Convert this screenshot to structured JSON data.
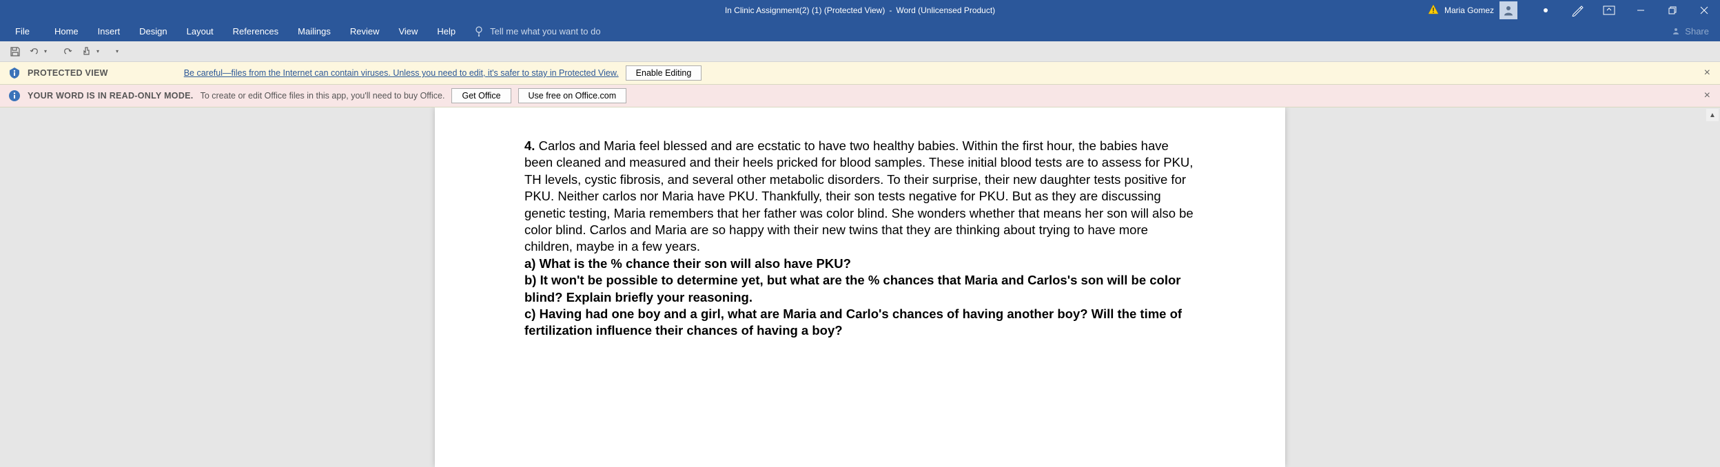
{
  "title": {
    "docname": "In Clinic Assignment(2) (1) (Protected View)",
    "dash": "  -  ",
    "app": "Word (Unlicensed Product)"
  },
  "user": {
    "name": "Maria Gomez"
  },
  "tabs": {
    "file": "File",
    "home": "Home",
    "insert": "Insert",
    "design": "Design",
    "layout": "Layout",
    "references": "References",
    "mailings": "Mailings",
    "review": "Review",
    "view": "View",
    "help": "Help",
    "tellme": "Tell me what you want to do",
    "share": "Share"
  },
  "msg1": {
    "label": "PROTECTED VIEW",
    "text": "Be careful—files from the Internet can contain viruses. Unless you need to edit, it's safer to stay in Protected View.",
    "btn": "Enable Editing"
  },
  "msg2": {
    "label": "YOUR WORD IS IN READ-ONLY MODE.",
    "text": "To create or edit Office files in this app, you'll need to buy Office.",
    "btn1": "Get Office",
    "btn2": "Use free on Office.com"
  },
  "doc": {
    "q4num": "4. ",
    "q4body": "Carlos and Maria feel blessed and are ecstatic to have two healthy babies. Within the first hour, the babies have been cleaned and measured and their heels pricked for blood samples. These initial blood tests are to assess for PKU, TH levels, cystic fibrosis, and several other metabolic disorders. To their surprise, their new daughter tests positive for PKU. Neither carlos nor Maria have PKU. Thankfully, their son tests negative for PKU. But as they are discussing genetic testing, Maria remembers that her father was color blind. She wonders whether that means her son will also be color blind. Carlos and Maria are so happy with their new twins that they are thinking about trying to have more children, maybe in a few years.",
    "qa": "a) What is the % chance their son will also have PKU?",
    "qb": "b) It won't be possible to determine yet, but what are the % chances that Maria and Carlos's son will be color blind? Explain briefly your reasoning.",
    "qc": "c) Having had one boy and a girl, what are Maria and Carlo's chances of having another boy? Will the time of fertilization influence their chances of having a boy?"
  }
}
